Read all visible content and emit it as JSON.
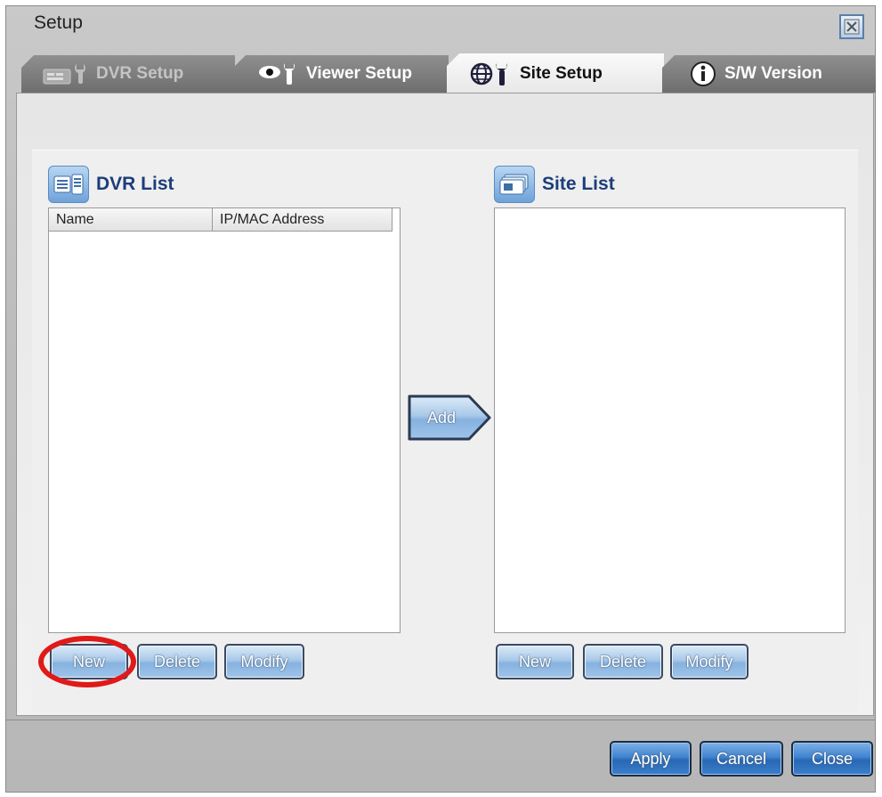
{
  "window": {
    "title": "Setup",
    "close_icon": "close-icon"
  },
  "tabs": [
    {
      "label": "DVR Setup",
      "icon": "dvr-wrench-icon",
      "state": "disabled"
    },
    {
      "label": "Viewer Setup",
      "icon": "eye-wrench-icon",
      "state": "normal"
    },
    {
      "label": "Site Setup",
      "icon": "globe-wrench-icon",
      "state": "active"
    },
    {
      "label": "S/W Version",
      "icon": "info-icon",
      "state": "normal"
    }
  ],
  "dvr_list": {
    "title": "DVR List",
    "columns": [
      "Name",
      "IP/MAC Address"
    ],
    "rows": [],
    "buttons": {
      "new": "New",
      "delete": "Delete",
      "modify": "Modify"
    }
  },
  "add_button": {
    "label": "Add"
  },
  "site_list": {
    "title": "Site List",
    "rows": [],
    "buttons": {
      "new": "New",
      "delete": "Delete",
      "modify": "Modify"
    }
  },
  "footer": {
    "apply": "Apply",
    "cancel": "Cancel",
    "close": "Close"
  },
  "colors": {
    "highlight": "#e01919",
    "heading": "#1c3d7a",
    "button_blue": "#86b2df"
  }
}
